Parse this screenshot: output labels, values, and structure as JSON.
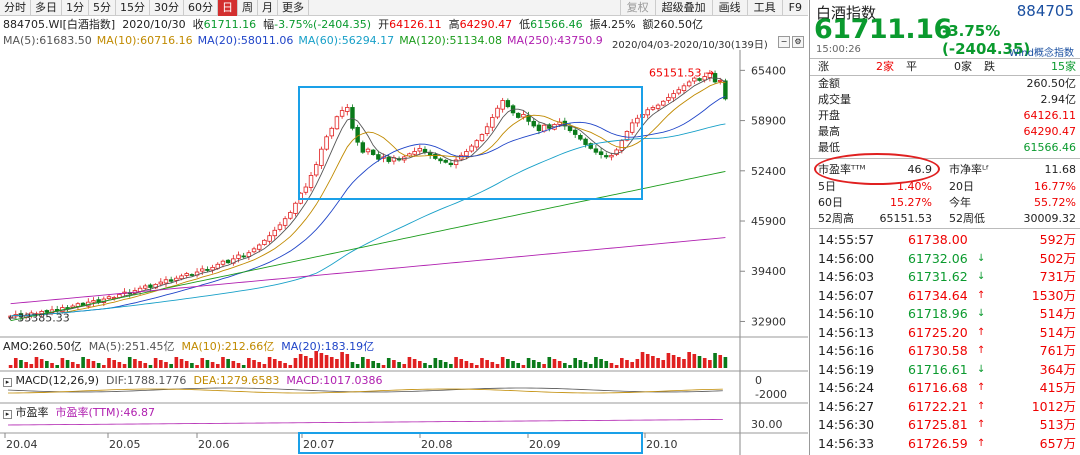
{
  "periods": [
    "分时",
    "多日",
    "1分",
    "5分",
    "15分",
    "30分",
    "60分",
    "日",
    "周",
    "月",
    "更多"
  ],
  "active_period": "日",
  "toolbar_right": [
    "复权",
    "超级叠加",
    "画线",
    "工具",
    "F9"
  ],
  "header": {
    "code_label": "884705.WI[白酒指数]",
    "date": "2020/10/30",
    "close_label": "收",
    "close": "61711.16",
    "amp_label": "幅",
    "amp": "-3.75%(-2404.35)",
    "open_label": "开",
    "open": "64126.11",
    "high_label": "高",
    "high": "64290.47",
    "low_label": "低",
    "low": "61566.46",
    "swing_label": "振",
    "swing": "4.25%",
    "amount_label": "额",
    "amount": "260.50亿"
  },
  "ma_line": [
    {
      "text": "MA(5):61683.50",
      "color": "#555555"
    },
    {
      "text": "MA(10):60716.16",
      "color": "#c08a00"
    },
    {
      "text": "MA(20):58011.06",
      "color": "#2045c8"
    },
    {
      "text": "MA(60):56294.17",
      "color": "#18a0c8"
    },
    {
      "text": "MA(120):51134.08",
      "color": "#1c9c1c"
    },
    {
      "text": "MA(250):43750.9",
      "color": "#b020b0"
    }
  ],
  "range_text": "2020/04/03-2020/10/30(139日)",
  "chart_data": {
    "type": "candlestick",
    "y_ticks": [
      65400,
      58900,
      52400,
      45900,
      39400,
      32900
    ],
    "ylim": [
      30500,
      67000
    ],
    "x_ticks": [
      "20.04",
      "20.05",
      "20.06",
      "20.07",
      "20.08",
      "20.09",
      "20.10"
    ],
    "annotations": [
      {
        "text": "65151.53",
        "value": 65151.53
      },
      {
        "text": "33385.33",
        "value": 33385.33
      }
    ],
    "closes": [
      33600,
      33800,
      33500,
      33700,
      34000,
      33900,
      34200,
      34100,
      34400,
      34300,
      34700,
      34600,
      34900,
      35200,
      35000,
      35400,
      35600,
      35400,
      35800,
      36100,
      36000,
      36400,
      36700,
      36500,
      36900,
      37200,
      37500,
      37300,
      37700,
      38000,
      38300,
      38100,
      38500,
      38800,
      39100,
      38900,
      39300,
      39700,
      39500,
      39900,
      40300,
      40700,
      40500,
      41000,
      41500,
      41300,
      41800,
      42300,
      42800,
      43400,
      44000,
      44700,
      45400,
      46200,
      47000,
      48200,
      49500,
      50300,
      51800,
      53200,
      55200,
      56800,
      57900,
      59400,
      60200,
      60600,
      57900,
      56100,
      54800,
      55200,
      54500,
      53900,
      54200,
      53600,
      54100,
      53800,
      54200,
      54600,
      54900,
      55300,
      54800,
      54400,
      54000,
      53700,
      53500,
      53200,
      53800,
      54400,
      54900,
      55600,
      56300,
      57100,
      58100,
      59300,
      60500,
      61500,
      60700,
      59900,
      59300,
      59700,
      58800,
      58200,
      57600,
      58300,
      57900,
      58400,
      58700,
      58200,
      57600,
      57100,
      56500,
      55800,
      55300,
      54800,
      54500,
      54200,
      54400,
      55100,
      56300,
      57500,
      58600,
      59200,
      59700,
      60300,
      60600,
      60900,
      61400,
      61900,
      62400,
      62900,
      63400,
      63900,
      64400,
      64100,
      64600,
      65000,
      63900,
      64100,
      61711
    ]
  },
  "amo": {
    "label": "AMO:260.50亿",
    "ma5": "MA(5):251.45亿",
    "ma10": "MA(10):212.66亿",
    "ma20": "MA(20):183.19亿"
  },
  "macd": {
    "label": "MACD(12,26,9)",
    "dif": "DIF:1788.1776",
    "dea": "DEA:1279.6583",
    "macd": "MACD:1017.0386",
    "tick_zero": "0",
    "tick_neg": "-2000"
  },
  "pe_panel": {
    "title": "市盈率",
    "value": "市盈率(TTM):46.87",
    "tick": "30.00"
  },
  "quote": {
    "name": "白酒指数",
    "code": "884705",
    "price": "61711.16",
    "change": "-3.75% (-2404.35)",
    "time": "15:00:26",
    "concept": "Wind概念指数",
    "breadth": {
      "up_label": "涨",
      "up": "2家",
      "flat_label": "平",
      "flat": "0家",
      "down_label": "跌",
      "down": "15家"
    },
    "stats": [
      {
        "k": "金额",
        "v": "260.50亿"
      },
      {
        "k": "成交量",
        "v": "2.94亿"
      },
      {
        "k": "开盘",
        "v": "64126.11",
        "c": "red"
      },
      {
        "k": "最高",
        "v": "64290.47",
        "c": "red"
      },
      {
        "k": "最低",
        "v": "61566.46",
        "c": "grn"
      }
    ],
    "pe_label": "市盈率ᵀᵀᴹ",
    "pe": "46.9",
    "pb_label": "市净率ᴸᶠ",
    "pb": "11.68",
    "perf": [
      {
        "k1": "5日",
        "v1": "1.40%",
        "k2": "20日",
        "v2": "16.77%"
      },
      {
        "k1": "60日",
        "v1": "15.27%",
        "k2": "今年",
        "v2": "55.72%"
      }
    ],
    "wk52": {
      "k1": "52周高",
      "v1": "65151.53",
      "k2": "52周低",
      "v2": "30009.32"
    }
  },
  "ticks": [
    {
      "t": "14:55:57",
      "p": "61738.00",
      "d": "",
      "v": "592万"
    },
    {
      "t": "14:56:00",
      "p": "61732.06",
      "d": "down",
      "v": "502万"
    },
    {
      "t": "14:56:03",
      "p": "61731.62",
      "d": "down",
      "v": "731万"
    },
    {
      "t": "14:56:07",
      "p": "61734.64",
      "d": "up",
      "v": "1530万"
    },
    {
      "t": "14:56:10",
      "p": "61718.96",
      "d": "down",
      "v": "514万"
    },
    {
      "t": "14:56:13",
      "p": "61725.20",
      "d": "up",
      "v": "514万"
    },
    {
      "t": "14:56:16",
      "p": "61730.58",
      "d": "up",
      "v": "761万"
    },
    {
      "t": "14:56:19",
      "p": "61716.61",
      "d": "down",
      "v": "364万"
    },
    {
      "t": "14:56:24",
      "p": "61716.68",
      "d": "up",
      "v": "415万"
    },
    {
      "t": "14:56:27",
      "p": "61722.21",
      "d": "up",
      "v": "1012万"
    },
    {
      "t": "14:56:30",
      "p": "61725.81",
      "d": "up",
      "v": "513万"
    },
    {
      "t": "14:56:33",
      "p": "61726.59",
      "d": "up",
      "v": "657万"
    }
  ]
}
